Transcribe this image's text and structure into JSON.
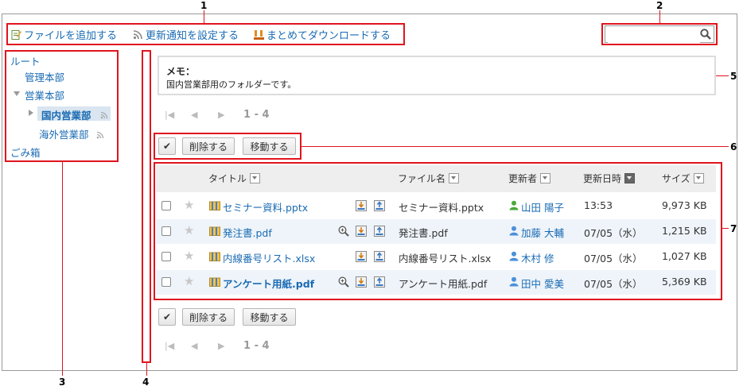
{
  "callouts": [
    "1",
    "2",
    "3",
    "4",
    "5",
    "6",
    "7"
  ],
  "toolbar": {
    "add_file": "ファイルを追加する",
    "notify_settings": "更新通知を設定する",
    "bulk_download": "まとめてダウンロードする"
  },
  "search": {
    "value": "",
    "placeholder": ""
  },
  "tree": {
    "root": "ルート",
    "items": [
      "管理本部",
      "営業本部",
      "国内営業部",
      "海外営業部",
      "ごみ箱"
    ]
  },
  "memo": {
    "title": "メモ：",
    "text": "国内営業部用のフォルダーです。"
  },
  "pager": {
    "label": "1 - 4"
  },
  "actions": {
    "check_all": "✔",
    "delete": "削除する",
    "move": "移動する"
  },
  "table": {
    "headers": [
      "タイトル",
      "ファイル名",
      "更新者",
      "更新日時",
      "サイズ"
    ],
    "rows": [
      {
        "title": "セミナー資料.pptx",
        "file": "セミナー資料.pptx",
        "user": "山田 陽子",
        "date": "13:53",
        "size": "9,973 KB",
        "bold": false,
        "user_color": "green"
      },
      {
        "title": "発注書.pdf",
        "file": "発注書.pdf",
        "user": "加藤 大輔",
        "date": "07/05（水）",
        "size": "1,215 KB",
        "bold": false,
        "user_color": "blue"
      },
      {
        "title": "内線番号リスト.xlsx",
        "file": "内線番号リスト.xlsx",
        "user": "木村 修",
        "date": "07/05（水）",
        "size": "1,027 KB",
        "bold": false,
        "user_color": "blue"
      },
      {
        "title": "アンケート用紙.pdf",
        "file": "アンケート用紙.pdf",
        "user": "田中 愛美",
        "date": "07/05（水）",
        "size": "5,369 KB",
        "bold": true,
        "user_color": "blue"
      }
    ]
  },
  "colors": {
    "accent": "#1a6bb3",
    "callout_red": "#e0141e",
    "row_alt": "#eef4fa",
    "header_bg": "#eeeeee"
  }
}
